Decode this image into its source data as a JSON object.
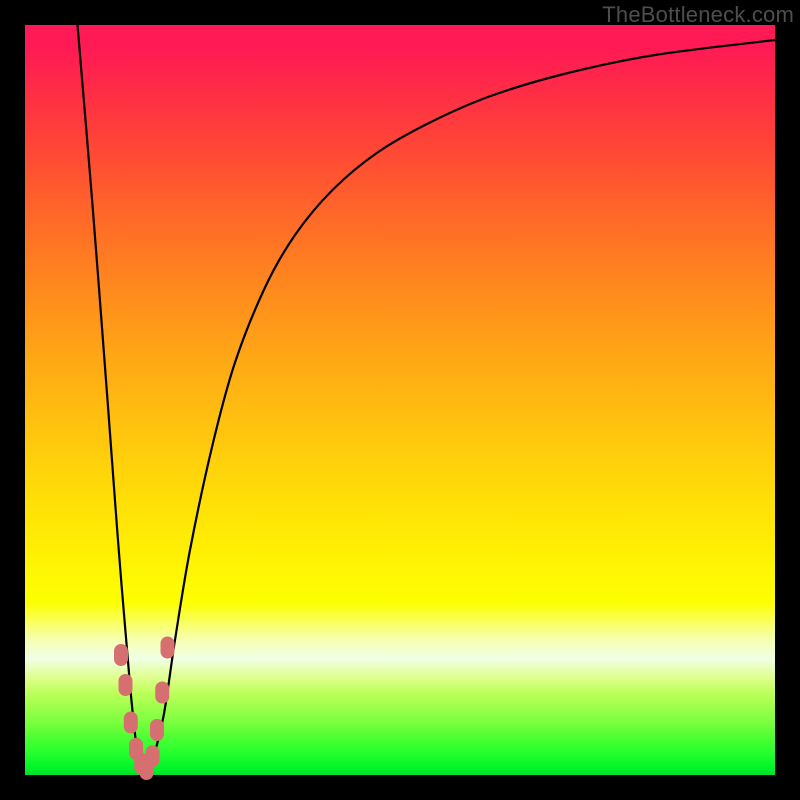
{
  "watermark": "TheBottleneck.com",
  "chart_data": {
    "type": "line",
    "title": "",
    "xlabel": "",
    "ylabel": "",
    "xlim": [
      0,
      100
    ],
    "ylim": [
      0,
      100
    ],
    "series": [
      {
        "name": "bottleneck-curve",
        "x": [
          7,
          9,
          11,
          12.5,
          14,
          15,
          16,
          17,
          18.5,
          20,
          22,
          25,
          28,
          32,
          36,
          41,
          47,
          54,
          62,
          72,
          84,
          100
        ],
        "values": [
          100,
          76,
          50,
          30,
          12,
          3,
          0,
          2,
          8,
          18,
          30,
          44,
          55,
          65,
          72,
          78,
          83,
          87,
          90.5,
          93.5,
          96,
          98
        ]
      }
    ],
    "markers": {
      "name": "highlight-cluster",
      "color": "#d66f6f",
      "points": [
        {
          "x": 12.8,
          "y": 16
        },
        {
          "x": 13.4,
          "y": 12
        },
        {
          "x": 14.1,
          "y": 7
        },
        {
          "x": 14.8,
          "y": 3.5
        },
        {
          "x": 15.5,
          "y": 1.5
        },
        {
          "x": 16.2,
          "y": 0.8
        },
        {
          "x": 17.0,
          "y": 2.5
        },
        {
          "x": 17.6,
          "y": 6
        },
        {
          "x": 18.3,
          "y": 11
        },
        {
          "x": 19.0,
          "y": 17
        }
      ]
    }
  },
  "colors": {
    "frame": "#000000",
    "curve": "#000000",
    "marker": "#d66f6f"
  }
}
